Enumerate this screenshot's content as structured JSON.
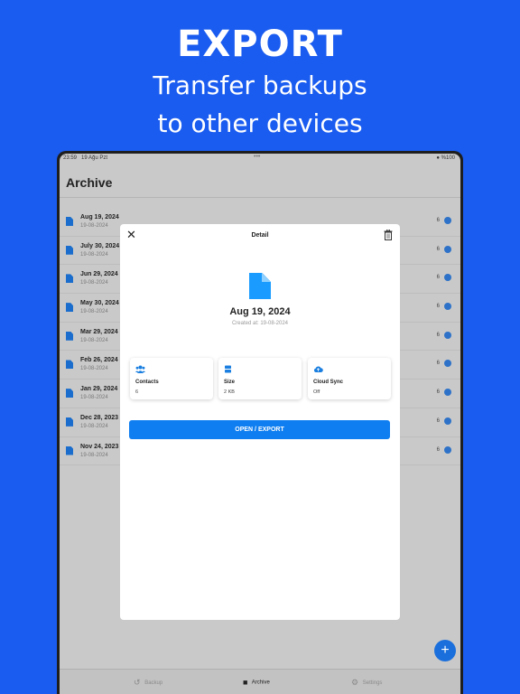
{
  "hero": {
    "title": "EXPORT",
    "subtitle_line1": "Transfer backups",
    "subtitle_line2": "to other devices"
  },
  "statusbar": {
    "time": "23:59",
    "date": "19 Ağu Pzt",
    "dots": "•••",
    "battery": "%100"
  },
  "archive": {
    "title": "Archive",
    "items": [
      {
        "title": "Aug 19, 2024",
        "subtitle": "19-08-2024",
        "count": "6"
      },
      {
        "title": "July 30, 2024",
        "subtitle": "19-08-2024",
        "count": "6"
      },
      {
        "title": "Jun 29, 2024",
        "subtitle": "19-08-2024",
        "count": "6"
      },
      {
        "title": "May 30, 2024",
        "subtitle": "19-08-2024",
        "count": "6"
      },
      {
        "title": "Mar 29, 2024",
        "subtitle": "19-08-2024",
        "count": "6"
      },
      {
        "title": "Feb 26, 2024",
        "subtitle": "19-08-2024",
        "count": "6"
      },
      {
        "title": "Jan 29, 2024",
        "subtitle": "19-08-2024",
        "count": "6"
      },
      {
        "title": "Dec 28, 2023",
        "subtitle": "19-08-2024",
        "count": "6"
      },
      {
        "title": "Nov 24, 2023",
        "subtitle": "19-08-2024",
        "count": "6"
      }
    ]
  },
  "fab": {
    "label": "+"
  },
  "tabbar": {
    "backup": "Backup",
    "archive": "Archive",
    "settings": "Settings"
  },
  "detail": {
    "title": "Detail",
    "date": "Aug 19, 2024",
    "created": "Created at: 19-08-2024",
    "cards": [
      {
        "label": "Contacts",
        "value": "6",
        "icon": "contacts-icon"
      },
      {
        "label": "Size",
        "value": "2 KB",
        "icon": "storage-icon"
      },
      {
        "label": "Cloud Sync",
        "value": "Off",
        "icon": "cloud-icon"
      }
    ],
    "button": "OPEN / EXPORT"
  },
  "colors": {
    "background": "#1a5cf0",
    "accent": "#0f7ef0",
    "doc_icon": "#1a9bff"
  }
}
